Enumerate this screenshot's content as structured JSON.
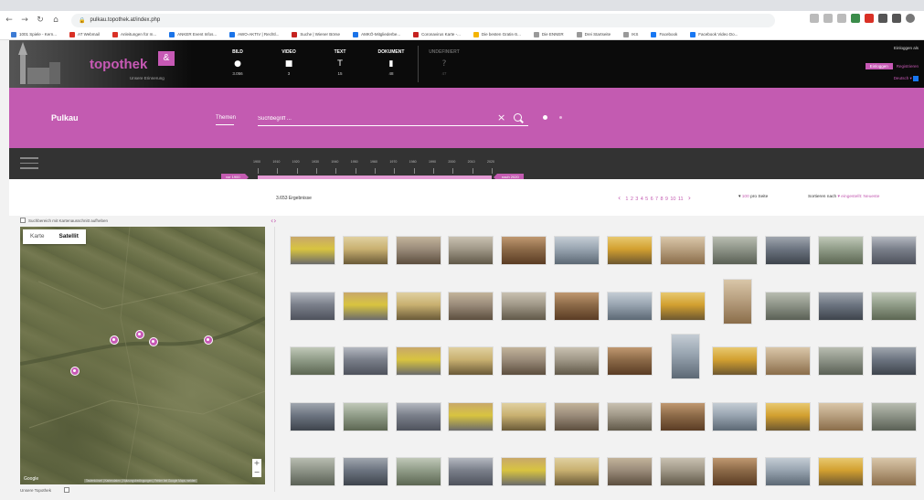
{
  "browser": {
    "url": "pulkau.topothek.at/index.php",
    "bookmarks": [
      "1001 Spiele - Kern...",
      "AT Webmail",
      "Anleitungen für m...",
      "ANKER Event Infos...",
      "AWO-AKTIV | Rechtl...",
      "Suche | Wiener Börse",
      "AMKÖ-Mitgliederbe...",
      "Coronavirus Karte -...",
      "Die besten Gratis-S...",
      "Die ENNER",
      "Drei Startseite",
      "IKS",
      "Facebook",
      "Facebook Video Do..."
    ]
  },
  "header": {
    "logo": "topothek",
    "tagline": "Unsere Erinnerung",
    "media": [
      {
        "label": "BILD",
        "count": "3.056",
        "icon": "camera-icon"
      },
      {
        "label": "VIDEO",
        "count": "3",
        "icon": "video-icon"
      },
      {
        "label": "TEXT",
        "count": "15",
        "icon": "text-icon"
      },
      {
        "label": "DOKUMENT",
        "count": "48",
        "icon": "document-icon"
      },
      {
        "label": "UNDEFINIERT",
        "count": "47",
        "icon": "question-icon"
      }
    ],
    "user": "Einloggen als",
    "login": "Einloggen",
    "register": "Registrieren",
    "language": "Deutsch"
  },
  "band": {
    "topothek_name": "Pulkau",
    "themen": "Themen",
    "search_placeholder": "Suchbegriff ..."
  },
  "timeline": {
    "from": "vor 1900",
    "to": "nach 2020",
    "years": [
      "1900",
      "1910",
      "1920",
      "1930",
      "1940",
      "1950",
      "1960",
      "1970",
      "1980",
      "1990",
      "2000",
      "2010",
      "2020"
    ]
  },
  "results": {
    "count": "3.653 Ergebnisse",
    "pages": [
      "1",
      "2",
      "3",
      "4",
      "5",
      "6",
      "7",
      "8",
      "9",
      "10",
      "11"
    ],
    "perpage_value": "100",
    "perpage_label": "pro Seite",
    "sort_label": "Sortieren nach",
    "sort_value": "eingestellt: Neueste"
  },
  "map": {
    "checkbox_label": "Suchbereich mit Kartenausschnitt aufheben",
    "tabs": [
      "Karte",
      "Satellit"
    ],
    "active_tab": "Satellit",
    "google": "Google",
    "attribution": "Tastenkürzel | Kartendaten | Nutzungsbedingungen | Fehler bei Google Maps melden",
    "footer_label": "Unsere Topothek"
  },
  "colors": {
    "accent": "#c35bb1",
    "header_bg": "#0b0b0b",
    "timeline_bg": "#333333"
  }
}
